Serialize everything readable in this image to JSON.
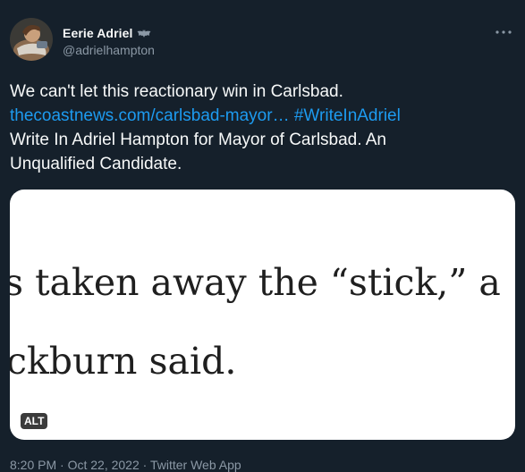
{
  "author": {
    "display_name": "Eerie Adriel",
    "name_icon": "bat-emoji-icon",
    "handle": "@adrielhampton"
  },
  "more_icon": "more-options-icon",
  "tweet": {
    "line1": "We can't let this reactionary win in Carlsbad.",
    "link_url_text": "thecoastnews.com/carlsbad-mayor…",
    "hashtag": "#WriteInAdriel",
    "line3": "Write In Adriel Hampton for Mayor of Carlsbad. An",
    "line4": "Unqualified Candidate."
  },
  "media": {
    "text_line1": "s taken away the “stick,” a",
    "text_line2": "ckburn said.",
    "alt_label": "ALT"
  },
  "meta": {
    "time": "8:20 PM",
    "separator": "·",
    "date": "Oct 22, 2022",
    "app": "Twitter Web App"
  },
  "colors": {
    "background": "#15202b",
    "text": "#f7f9f9",
    "secondary": "#8b98a5",
    "link": "#1d9bf0"
  }
}
